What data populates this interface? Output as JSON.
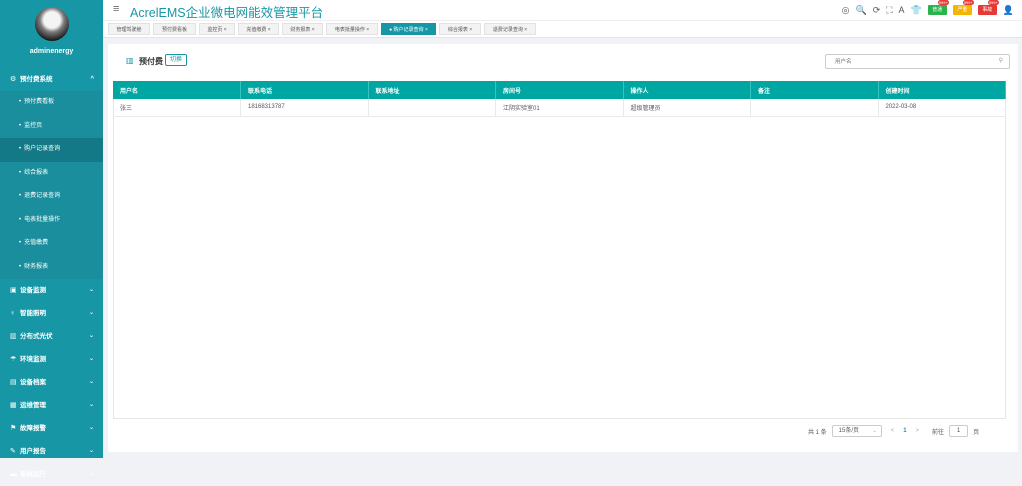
{
  "sidebar": {
    "username": "adminenergy",
    "menu": [
      {
        "icon": "prepaid-icon",
        "glyph": "⚙",
        "label": "预付费系统",
        "expanded": true,
        "chevron": "^"
      },
      {
        "sub": true,
        "label": "预付费看板"
      },
      {
        "sub": true,
        "label": "监控页"
      },
      {
        "sub": true,
        "label": "购户记录查询",
        "active": true
      },
      {
        "sub": true,
        "label": "综合报表"
      },
      {
        "sub": true,
        "label": "退费记录查询"
      },
      {
        "sub": true,
        "label": "电表批量操作"
      },
      {
        "sub": true,
        "label": "充值缴费"
      },
      {
        "sub": true,
        "label": "财务报表"
      },
      {
        "icon": "monitor-icon",
        "glyph": "▣",
        "label": "设备监测",
        "chevron": "⌄"
      },
      {
        "icon": "lightbulb-icon",
        "glyph": "♀",
        "label": "智能照明",
        "chevron": "⌄"
      },
      {
        "icon": "solar-icon",
        "glyph": "▥",
        "label": "分布式光伏",
        "chevron": "⌄"
      },
      {
        "icon": "environment-icon",
        "glyph": "☂",
        "label": "环境监测",
        "chevron": "⌄"
      },
      {
        "icon": "archive-icon",
        "glyph": "▤",
        "label": "设备档案",
        "chevron": "⌄"
      },
      {
        "icon": "maintenance-icon",
        "glyph": "▦",
        "label": "运维管理",
        "chevron": "⌄"
      },
      {
        "icon": "alarm-icon",
        "glyph": "⚑",
        "label": "故障报警",
        "chevron": "⌄"
      },
      {
        "icon": "report-icon",
        "glyph": "✎",
        "label": "用户报告",
        "chevron": "⌄"
      },
      {
        "icon": "system-icon",
        "glyph": "▬",
        "label": "系统运行",
        "chevron": "⌄"
      }
    ]
  },
  "header": {
    "title": "AcrelEMS企业微电网能效管理平台",
    "icons": [
      {
        "name": "help-icon",
        "glyph": "◎"
      },
      {
        "name": "search-icon",
        "glyph": "🔍"
      },
      {
        "name": "refresh-icon",
        "glyph": "⟳"
      },
      {
        "name": "fullscreen-icon",
        "glyph": "⛶"
      },
      {
        "name": "font-size-icon",
        "glyph": "A"
      },
      {
        "name": "theme-icon",
        "glyph": "👕"
      }
    ],
    "badges": [
      {
        "name": "normal-badge",
        "label": "普通",
        "count": "999+",
        "color": "#2bb24c"
      },
      {
        "name": "important-badge",
        "label": "严重",
        "count": "999+",
        "color": "#f5b400"
      },
      {
        "name": "emergency-badge",
        "label": "事故",
        "count": "999+",
        "color": "#e53935"
      }
    ],
    "user_icon": "user-icon"
  },
  "tabs": [
    {
      "label": "管理驾驶舱",
      "closable": false
    },
    {
      "label": "预付费看板",
      "closable": false
    },
    {
      "label": "监控页",
      "closable": true
    },
    {
      "label": "充值缴费",
      "closable": true
    },
    {
      "label": "财务报表",
      "closable": true
    },
    {
      "label": "电表批量操作",
      "closable": true
    },
    {
      "label": "购户记录查询",
      "closable": true,
      "active": true
    },
    {
      "label": "综合报表",
      "closable": true
    },
    {
      "label": "退费记录查询",
      "closable": true
    }
  ],
  "main": {
    "header_title": "预付费",
    "switch_label": "切换",
    "search_placeholder": "用户名",
    "columns": [
      "用户名",
      "联系电话",
      "联系地址",
      "房间号",
      "操作人",
      "备注",
      "创建时间"
    ],
    "rows": [
      [
        "张三",
        "18168313787",
        "",
        "江阴实验室01",
        "超级管理员",
        "",
        "2022-03-08"
      ]
    ]
  },
  "pagination": {
    "total": "共 1 条",
    "page_size": "15条/页",
    "prev": "<",
    "current": "1",
    "next": ">",
    "goto_label": "前往",
    "goto_value": "1",
    "page_unit": "页"
  },
  "colors": {
    "accent": "#1797a6",
    "table_header": "#00a7a2"
  }
}
